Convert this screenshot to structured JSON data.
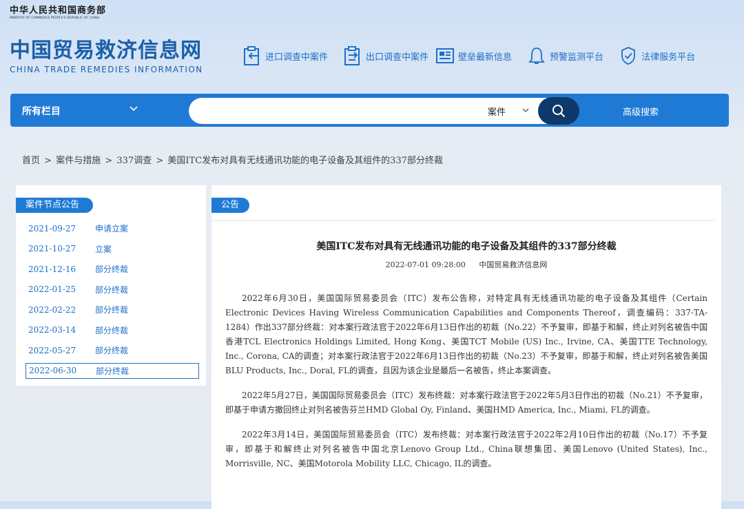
{
  "header": {
    "ministry_cn": "中华人民共和国商务部",
    "ministry_en": "MINISTRY OF COMMERCE PEOPLE'S REPUBLIC OF CHINA",
    "logo_cn": "中国贸易救济信息网",
    "logo_en": "CHINA TRADE REMEDIES INFORMATION",
    "nav": [
      {
        "label": "进口调查中案件",
        "icon": "import-case-icon"
      },
      {
        "label": "出口调查中案件",
        "icon": "export-case-icon"
      },
      {
        "label": "壁垒最新信息",
        "icon": "barrier-info-icon"
      },
      {
        "label": "预警监测平台",
        "icon": "bell-icon"
      },
      {
        "label": "法律服务平台",
        "icon": "shield-check-icon"
      }
    ]
  },
  "search": {
    "all_columns": "所有栏目",
    "query": "",
    "category": "案件",
    "advanced": "高级搜索"
  },
  "breadcrumb": {
    "home": "首页",
    "level1": "案件与措施",
    "level2": "337调查",
    "current": "美国ITC发布对具有无线通讯功能的电子设备及其组件的337部分终裁"
  },
  "sidebar": {
    "title": "案件节点公告",
    "items": [
      {
        "date": "2021-09-27",
        "label": "申请立案"
      },
      {
        "date": "2021-10-27",
        "label": "立案"
      },
      {
        "date": "2021-12-16",
        "label": "部分终裁"
      },
      {
        "date": "2022-01-25",
        "label": "部分终裁"
      },
      {
        "date": "2022-02-22",
        "label": "部分终裁"
      },
      {
        "date": "2022-03-14",
        "label": "部分终裁"
      },
      {
        "date": "2022-05-27",
        "label": "部分终裁"
      },
      {
        "date": "2022-06-30",
        "label": "部分终裁"
      }
    ]
  },
  "article": {
    "tag": "公告",
    "title": "美国ITC发布对具有无线通讯功能的电子设备及其组件的337部分终裁",
    "datetime": "2022-07-01 09:28:00",
    "source": "中国贸易救济信息网",
    "paragraphs": [
      "2022年6月30日，美国国际贸易委员会（ITC）发布公告称，对特定具有无线通讯功能的电子设备及其组件（Certain Electronic Devices Having Wireless Communication Capabilities and Components Thereof，调查编码：337-TA-1284）作出337部分终裁：对本案行政法官于2022年6月13日作出的初裁（No.22）不予复审，即基于和解，终止对列名被告中国香港TCL Electronics Holdings Limited, Hong Kong、美国TCT Mobile (US) Inc., Irvine, CA、美国TTE Technology, Inc., Corona, CA的调查；对本案行政法官于2022年6月13日作出的初裁（No.23）不予复审，即基于和解，终止对列名被告美国BLU Products, Inc., Doral, FL的调查，且因为该企业是最后一名被告，终止本案调查。",
      "2022年5月27日，美国国际贸易委员会（ITC）发布终裁：对本案行政法官于2022年5月3日作出的初裁（No.21）不予复审，即基于申请方撤回终止对列名被告芬兰HMD Global Oy, Finland、美国HMD America, Inc., Miami, FL的调查。",
      "2022年3月14日，美国国际贸易委员会（ITC）发布终裁：对本案行政法官于2022年2月10日作出的初裁（No.17）不予复审，即基于和解终止对列名被告中国北京Lenovo Group Ltd., China联想集团、美国Lenovo (United States), Inc., Morrisville, NC、美国Motorola Mobility LLC, Chicago, IL的调查。"
    ]
  }
}
